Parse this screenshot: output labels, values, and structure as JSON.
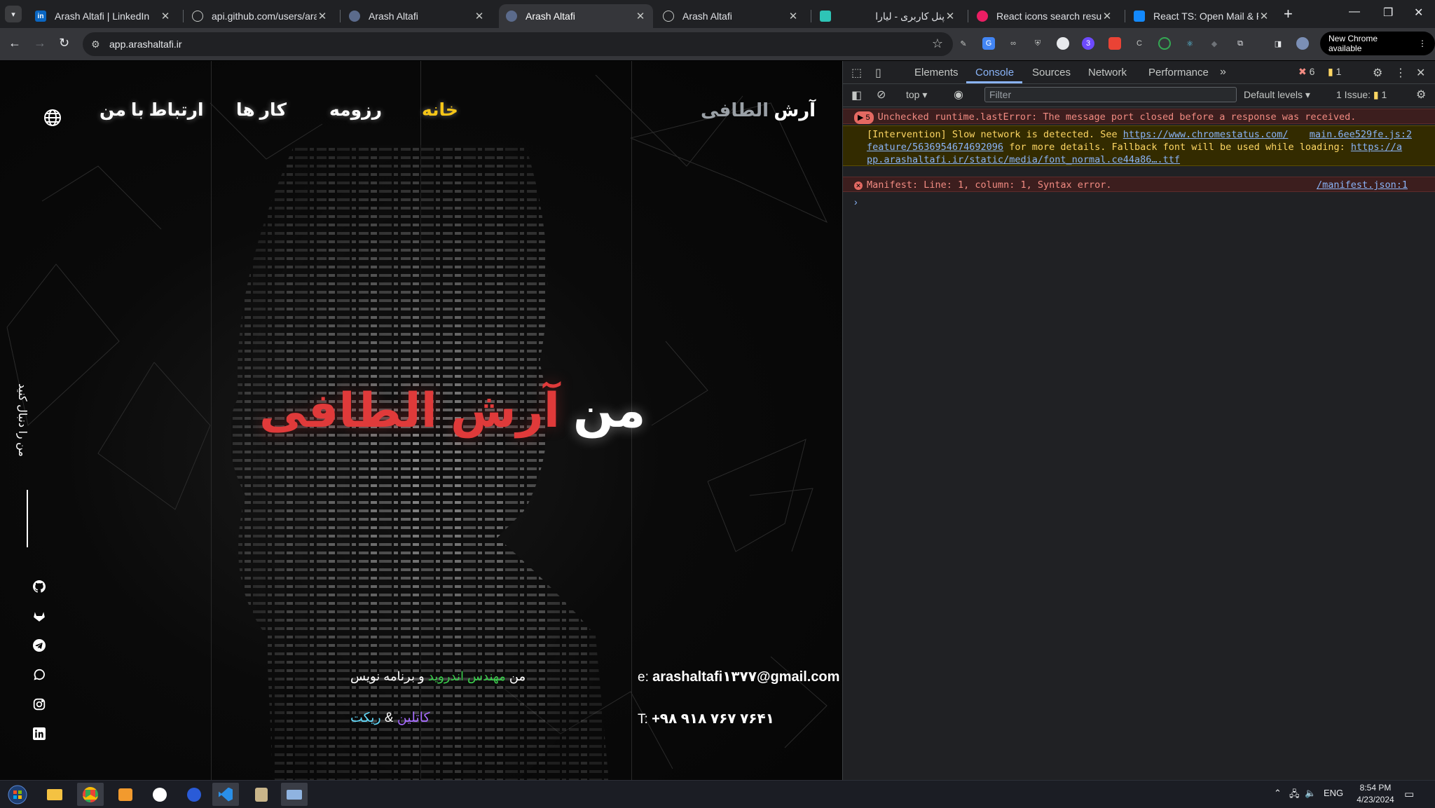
{
  "browser": {
    "tabs": [
      {
        "title": "Arash Altafi | LinkedIn",
        "favicon": "linkedin-icon",
        "active": false
      },
      {
        "title": "api.github.com/users/arashaltafi",
        "favicon": "globe-icon",
        "active": false
      },
      {
        "title": "Arash Altafi",
        "favicon": "site-icon",
        "active": false
      },
      {
        "title": "Arash Altafi",
        "favicon": "site-icon",
        "active": true
      },
      {
        "title": "Arash Altafi",
        "favicon": "globe-icon",
        "active": false
      },
      {
        "title": "پنل کاربری - لیارا",
        "favicon": "liara-icon",
        "active": false
      },
      {
        "title": "React icons search results",
        "favicon": "react-icons-icon",
        "active": false
      },
      {
        "title": "React TS: Open Mail & Phone",
        "favicon": "stackblitz-icon",
        "active": false
      }
    ],
    "url": "app.arashaltafi.ir",
    "new_chrome_label": "New Chrome available",
    "extension_badge": "3"
  },
  "site": {
    "brand_main": "آرش",
    "brand_muted": "الطافی",
    "nav": {
      "home": "خانه",
      "resume": "رزومه",
      "works": "کار ها",
      "contact": "ارتباط با من"
    },
    "hero_prefix": "من",
    "hero_name": "آرش الطافی",
    "follow_label": "من را دنبال کنید",
    "role_prefix": "من",
    "role_highlight": "مهندس اندروید",
    "role_suffix": "و برنامه نویس",
    "stack_kotlin": "کاتلین",
    "stack_amp": "&",
    "stack_react": "ریکت",
    "email_label": "e:",
    "email": "arashaltafi۱۳۷۷@gmail.com",
    "phone_label": "T:",
    "phone": "+۹۸ ۹۱۸ ۷۶۷ ۷۶۴۱",
    "social_icons": [
      "github-icon",
      "gitlab-icon",
      "telegram-icon",
      "whatsapp-icon",
      "instagram-icon",
      "linkedin-icon"
    ]
  },
  "devtools": {
    "tabs": [
      "Elements",
      "Console",
      "Sources",
      "Network",
      "Performance"
    ],
    "active_tab": "Console",
    "error_count": "6",
    "warning_count": "1",
    "context": "top",
    "filter_placeholder": "Filter",
    "levels": "Default levels",
    "issues_label": "1 Issue:",
    "issues_count": "1",
    "messages": {
      "error1_count": "5",
      "error1": "Unchecked runtime.lastError: The message port closed before a response was received.",
      "warn_pre": "[Intervention] Slow network is detected. See",
      "warn_link1": "https://www.chromestatus.com/",
      "warn_source": "main.6ee529fe.js:2",
      "warn_link1b": "feature/5636954674692096",
      "warn_mid": "for more details. Fallback font will be used while loading:",
      "warn_link2a": "https://a",
      "warn_link2b": "pp.arashaltafi.ir/static/media/font_normal.ce44a86….ttf",
      "error2": "Manifest: Line: 1, column: 1, Syntax error.",
      "error2_source": "/manifest.json:1"
    }
  },
  "taskbar": {
    "lang": "ENG",
    "time": "8:54 PM",
    "date": "4/23/2024"
  },
  "colors": {
    "accent_red": "#e03a3a",
    "nav_active": "#f5c518",
    "devtools_blue": "#8ab4f8",
    "kotlin": "#a66bff",
    "react": "#61dafb"
  }
}
